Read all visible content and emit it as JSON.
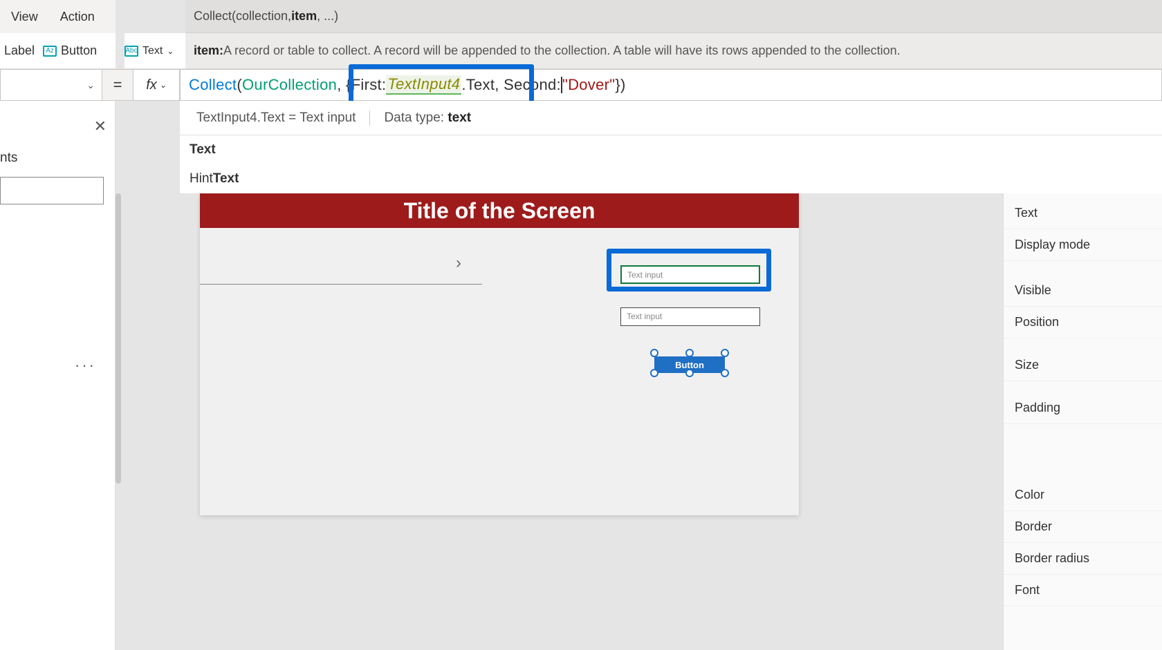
{
  "menu": {
    "view": "View",
    "action": "Action"
  },
  "ribbon": {
    "label": "Label",
    "button": "Button",
    "text": "Text",
    "label_abbr": "Az",
    "text_abbr": "Abc"
  },
  "signature": {
    "prefix": "Collect(collection, ",
    "bold": "item",
    "suffix": ", ...)"
  },
  "tooltip": {
    "label": "item:",
    "desc": " A record or table to collect. A record will be appended to the collection. A table will have its rows appended to the collection."
  },
  "equals": "=",
  "fx": "fx",
  "formula": {
    "fn": "Collect",
    "open": "(",
    "coll": "OurCollection",
    "comma1": ", ",
    "brace": "{",
    "k1": "First: ",
    "id": "TextInput4",
    "dot": ".Text, ",
    "k2": "Second: ",
    "cursor": "\"",
    "str": "Dover\"",
    "end": "})"
  },
  "info": {
    "seg1a": "TextInput4.Text  =  ",
    "seg1b": "Text input",
    "seg2a": "Data type: ",
    "seg2b": "text"
  },
  "suggest": {
    "r1": "Text",
    "r2a": "Hint",
    "r2b": "Text"
  },
  "left": {
    "nts": "nts",
    "ellipsis": "···"
  },
  "canvas": {
    "title": "Title of the Screen",
    "ti_placeholder": "Text input",
    "btn": "Button",
    "chev": "›"
  },
  "props": {
    "text": "Text",
    "displaymode": "Display mode",
    "visible": "Visible",
    "position": "Position",
    "size": "Size",
    "padding": "Padding",
    "color": "Color",
    "border": "Border",
    "borderradius": "Border radius",
    "font": "Font"
  }
}
